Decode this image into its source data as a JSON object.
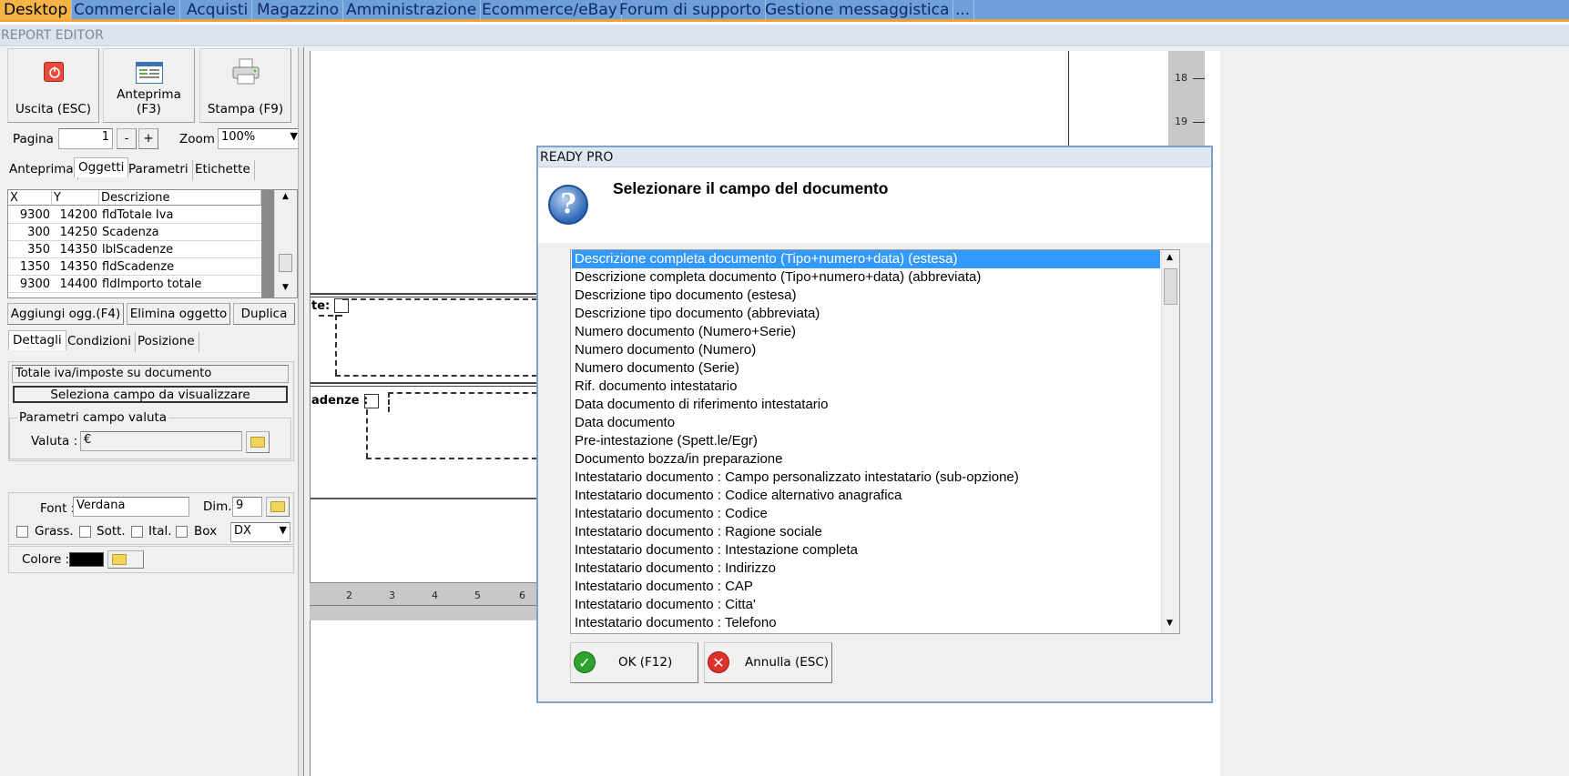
{
  "menu": {
    "tabs": [
      "Desktop",
      "Commerciale",
      "Acquisti",
      "Magazzino",
      "Amministrazione",
      "Ecommerce/eBay",
      "Forum di supporto",
      "Gestione messaggistica",
      "..."
    ]
  },
  "window": {
    "title": "REPORT EDITOR"
  },
  "toolbar": {
    "exit_label": "Uscita (ESC)",
    "preview_label": "Anteprima (F3)",
    "print_label": "Stampa (F9)"
  },
  "paging": {
    "page_label": "Pagina",
    "page_value": "1",
    "minus": "-",
    "plus": "+",
    "zoom_label": "Zoom",
    "zoom_value": "100%"
  },
  "tabs_top": [
    "Anteprima",
    "Oggetti",
    "Parametri",
    "Etichette"
  ],
  "grid": {
    "headers": [
      "X",
      "Y",
      "Descrizione"
    ],
    "rows": [
      {
        "x": "9300",
        "y": "14200",
        "desc": "fldTotale Iva"
      },
      {
        "x": "300",
        "y": "14250",
        "desc": "Scadenza"
      },
      {
        "x": "350",
        "y": "14350",
        "desc": "lblScadenze"
      },
      {
        "x": "1350",
        "y": "14350",
        "desc": "fldScadenze"
      },
      {
        "x": "9300",
        "y": "14400",
        "desc": "fldImporto totale"
      }
    ]
  },
  "object_buttons": {
    "add": "Aggiungi ogg.(F4)",
    "delete": "Elimina oggetto",
    "duplicate": "Duplica"
  },
  "tabs_bottom": [
    "Dettagli",
    "Condizioni",
    "Posizione"
  ],
  "details": {
    "field_text": "Totale iva/imposte su documento",
    "select_button": "Seleziona campo da visualizzare",
    "currency_group": "Parametri campo valuta",
    "currency_label": "Valuta :",
    "currency_value": "€"
  },
  "font": {
    "font_label": "Font :",
    "font_value": "Verdana",
    "size_label": "Dim.",
    "size_value": "9",
    "bold": "Grass.",
    "underline": "Sott.",
    "italic": "Ital.",
    "box": "Box",
    "align_value": "DX",
    "color_label": "Colore :",
    "color_value": "#000000"
  },
  "canvas": {
    "label_1": "te:",
    "label_2": "adenze :",
    "ruler_bottom": [
      "2",
      "3",
      "4",
      "5",
      "6"
    ],
    "ruler_right": [
      "18",
      "19"
    ]
  },
  "dialog": {
    "title": "READY PRO",
    "heading": "Selezionare il campo del documento",
    "items": [
      "Descrizione completa documento (Tipo+numero+data) (estesa)",
      "Descrizione completa documento (Tipo+numero+data) (abbreviata)",
      "Descrizione tipo documento (estesa)",
      "Descrizione tipo documento (abbreviata)",
      "Numero documento (Numero+Serie)",
      "Numero documento (Numero)",
      "Numero documento (Serie)",
      "Rif. documento intestatario",
      "Data documento di riferimento intestatario",
      "Data documento",
      "Pre-intestazione (Spett.le/Egr)",
      "Documento bozza/in preparazione",
      "Intestatario documento : Campo personalizzato intestatario (sub-opzione)",
      "Intestatario documento : Codice alternativo anagrafica",
      "Intestatario documento : Codice",
      "Intestatario documento : Ragione sociale",
      "Intestatario documento : Intestazione completa",
      "Intestatario documento : Indirizzo",
      "Intestatario documento : CAP",
      "Intestatario documento : Citta'",
      "Intestatario documento : Telefono"
    ],
    "selected_index": 0,
    "ok_label": "OK (F12)",
    "cancel_label": "Annulla (ESC)"
  }
}
